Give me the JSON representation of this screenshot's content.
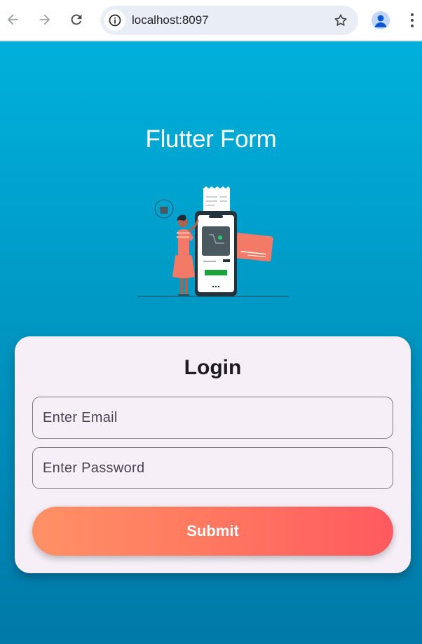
{
  "browser": {
    "url": "localhost:8097",
    "icons": [
      "back-arrow-icon",
      "forward-arrow-icon",
      "reload-icon",
      "info-icon",
      "star-icon",
      "profile-icon",
      "more-vert-icon"
    ]
  },
  "page": {
    "title": "Flutter Form",
    "colors": {
      "background_top": "#00b0dc",
      "background_bottom": "#0079a8",
      "card": "#f6eff8",
      "button_start": "#ff9166",
      "button_end": "#ff5a5f"
    }
  },
  "login": {
    "title": "Login",
    "email_placeholder": "Enter Email",
    "email_value": "",
    "password_placeholder": "Enter Password",
    "password_value": "",
    "submit_label": "Submit"
  }
}
